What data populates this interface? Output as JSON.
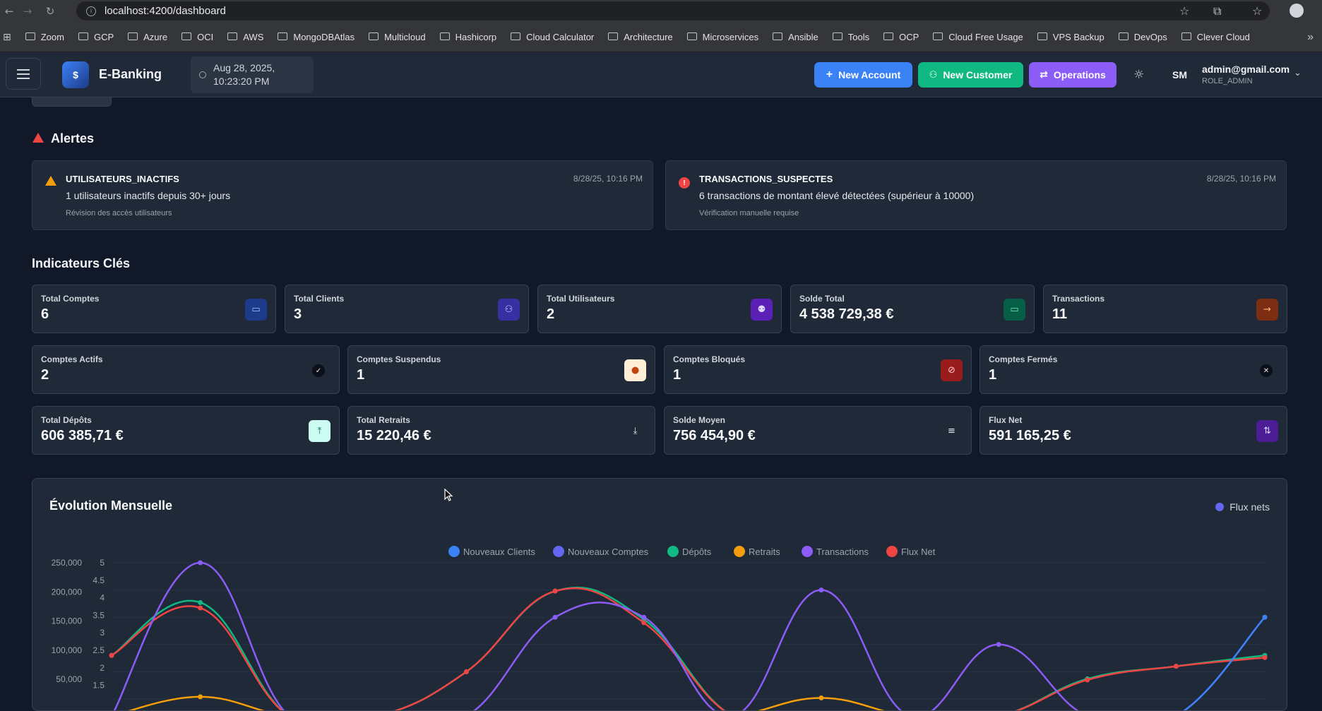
{
  "browser": {
    "url": "localhost:4200/dashboard"
  },
  "bookmarks": [
    "Zoom",
    "GCP",
    "Azure",
    "OCI",
    "AWS",
    "MongoDBAtlas",
    "Multicloud",
    "Hashicorp",
    "Cloud Calculator",
    "Architecture",
    "Microservices",
    "Ansible",
    "Tools",
    "OCP",
    "Cloud Free Usage",
    "VPS Backup",
    "DevOps",
    "Clever Cloud"
  ],
  "header": {
    "logo_text": "$",
    "app_title": "E-Banking",
    "date_line1": "Aug 28, 2025,",
    "date_line2": "10:23:20 PM",
    "btn_new_account": "New Account",
    "btn_new_customer": "New Customer",
    "btn_operations": "Operations",
    "user_initials": "SM",
    "user_email": "admin@gmail.com",
    "user_role": "ROLE_ADMIN",
    "colors": {
      "new_account": "#3b82f6",
      "new_customer": "#10b981",
      "operations": "#8b5cf6"
    }
  },
  "alerts": {
    "title": "Alertes",
    "items": [
      {
        "type": "UTILISATEURS_INACTIFS",
        "message": "1 utilisateurs inactifs depuis 30+ jours",
        "action": "Révision des accès utilisateurs",
        "date": "8/28/25, 10:16 PM",
        "icon": "warning-icon",
        "color": "#f59e0b"
      },
      {
        "type": "TRANSACTIONS_SUSPECTES",
        "message": "6 transactions de montant élevé détectées (supérieur à 10000)",
        "action": "Vérification manuelle requise",
        "date": "8/28/25, 10:16 PM",
        "icon": "error-icon",
        "color": "#ef4444"
      }
    ]
  },
  "kpis": {
    "title": "Indicateurs Clés",
    "row1": [
      {
        "label": "Total Comptes",
        "value": "6",
        "icon": "account-icon"
      },
      {
        "label": "Total Clients",
        "value": "3",
        "icon": "users-icon"
      },
      {
        "label": "Total Utilisateurs",
        "value": "2",
        "icon": "user-icon"
      },
      {
        "label": "Solde Total",
        "value": "4 538 729,38 €",
        "icon": "wallet-icon"
      },
      {
        "label": "Transactions",
        "value": "11",
        "icon": "arrow-right-icon"
      }
    ],
    "row2": [
      {
        "label": "Comptes Actifs",
        "value": "2",
        "icon": "check-circle-icon"
      },
      {
        "label": "Comptes Suspendus",
        "value": "1",
        "icon": "alert-circle-icon"
      },
      {
        "label": "Comptes Bloqués",
        "value": "1",
        "icon": "ban-icon"
      },
      {
        "label": "Comptes Fermés",
        "value": "1",
        "icon": "x-circle-icon"
      }
    ],
    "row3": [
      {
        "label": "Total Dépôts",
        "value": "606 385,71 €",
        "icon": "upload-icon"
      },
      {
        "label": "Total Retraits",
        "value": "15 220,46 €",
        "icon": "download-icon"
      },
      {
        "label": "Solde Moyen",
        "value": "756 454,90 €",
        "icon": "bars-icon"
      },
      {
        "label": "Flux Net",
        "value": "591 165,25 €",
        "icon": "exchange-icon"
      }
    ]
  },
  "chart": {
    "title": "Évolution Mensuelle",
    "toggle_label": "Flux nets"
  },
  "chart_data": {
    "type": "line",
    "title": "Évolution Mensuelle",
    "legend": [
      "Nouveaux Clients",
      "Nouveaux Comptes",
      "Dépôts",
      "Retraits",
      "Transactions",
      "Flux Net"
    ],
    "legend_colors": [
      "#3b82f6",
      "#6366f1",
      "#10b981",
      "#f59e0b",
      "#8b5cf6",
      "#ef4444"
    ],
    "y_left_ticks": [
      "250,000",
      "200,000",
      "150,000",
      "100,000",
      "50,000"
    ],
    "y_right_ticks": [
      "5",
      "4.5",
      "4",
      "3.5",
      "3",
      "2.5",
      "2",
      "1.5"
    ],
    "y_left_range": [
      0,
      250000
    ],
    "y_right_range": [
      0,
      5
    ],
    "x_points": 12,
    "series": [
      {
        "name": "Dépôts",
        "axis": "left",
        "color": "#10b981",
        "values": [
          80000,
          177000,
          0,
          0,
          50000,
          198000,
          146000,
          0,
          0,
          0,
          0,
          37000,
          60000,
          80000
        ]
      },
      {
        "name": "Flux Net",
        "axis": "left",
        "color": "#ef4444",
        "values": [
          80000,
          167000,
          0,
          0,
          50000,
          198000,
          140000,
          0,
          0,
          0,
          0,
          35000,
          60000,
          76000
        ]
      },
      {
        "name": "Transactions",
        "axis": "right",
        "color": "#8b5cf6",
        "values": [
          0,
          5,
          0,
          0,
          0,
          3,
          3,
          0,
          4,
          0,
          2,
          0,
          0,
          3
        ]
      },
      {
        "name": "Retraits",
        "axis": "left",
        "color": "#f59e0b",
        "values": [
          0,
          4000,
          0,
          0,
          0,
          0,
          0,
          0,
          2000,
          0,
          0,
          0,
          0,
          0
        ]
      },
      {
        "name": "Nouveaux Clients",
        "axis": "right",
        "color": "#3b82f6",
        "values": [
          0,
          0,
          0,
          0,
          0,
          0,
          0,
          0,
          0,
          0,
          0,
          0,
          0,
          3
        ]
      }
    ]
  }
}
